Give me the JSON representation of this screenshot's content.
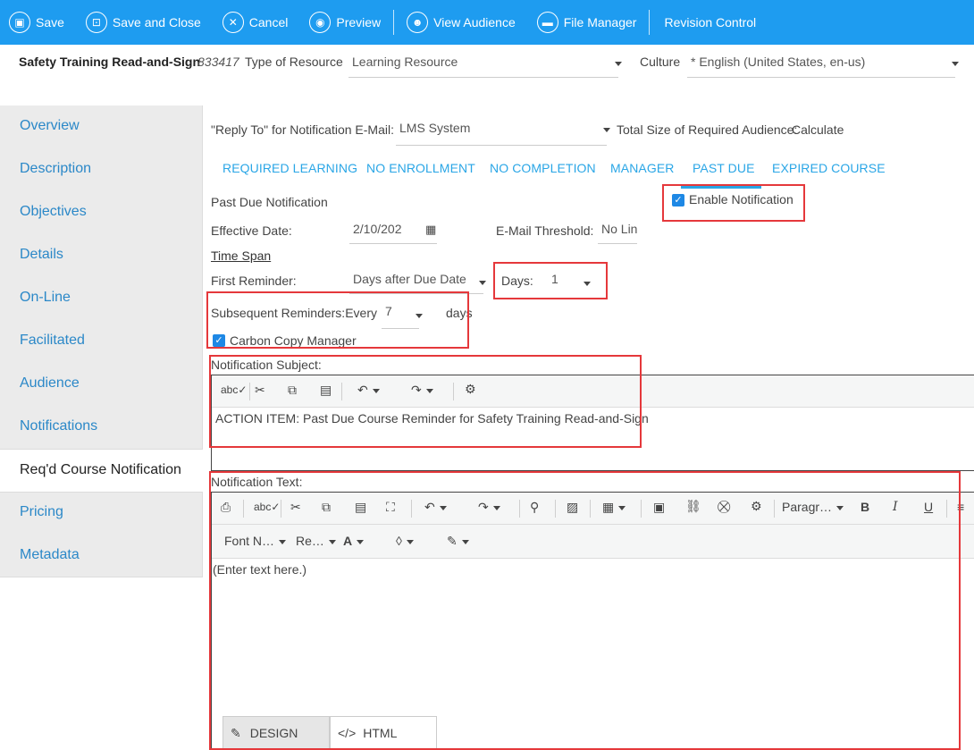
{
  "toolbar": {
    "save": "Save",
    "save_close": "Save and Close",
    "cancel": "Cancel",
    "preview": "Preview",
    "view_audience": "View Audience",
    "file_manager": "File Manager",
    "revision_control": "Revision Control"
  },
  "header": {
    "title": "Safety Training Read-and-Sign",
    "id": "833417",
    "type_label": "Type of Resource",
    "type_value": "Learning Resource",
    "culture_label": "Culture",
    "culture_value": "* English (United States, en-us)"
  },
  "sidebar": {
    "items": [
      "Overview",
      "Description",
      "Objectives",
      "Details",
      "On-Line",
      "Facilitated",
      "Audience",
      "Notifications",
      "Req'd Course Notification",
      "Pricing",
      "Metadata"
    ],
    "active_index": 8
  },
  "main": {
    "reply_to_label": "\"Reply To\" for Notification E-Mail:",
    "reply_to_value": "LMS System",
    "total_size_label": "Total Size of Required Audience:",
    "total_size_link": "Calculate",
    "tabs": [
      "REQUIRED LEARNING",
      "NO ENROLLMENT",
      "NO COMPLETION",
      "MANAGER",
      "PAST DUE",
      "EXPIRED COURSE"
    ],
    "active_tab": "PAST DUE",
    "section_title": "Past Due Notification",
    "enable_notification": "Enable Notification",
    "effective_date_label": "Effective Date:",
    "effective_date_value": "2/10/202",
    "email_threshold_label": "E-Mail Threshold:",
    "email_threshold_value": "No Lin",
    "time_span": "Time Span",
    "first_reminder_label": "First Reminder:",
    "first_reminder_value": "Days after Due Date",
    "days_label": "Days:",
    "days_value": "1",
    "subsequent_label": "Subsequent Reminders:Every",
    "subsequent_value": "7",
    "subsequent_unit": "days",
    "cc_manager": "Carbon Copy Manager",
    "subject_label": "Notification Subject:",
    "subject_value": "ACTION ITEM: Past Due Course Reminder for Safety Training Read-and-Sign",
    "text_label": "Notification Text:",
    "text_placeholder": "(Enter text here.)",
    "paragraph": "Paragr…",
    "font_name": "Font N…",
    "font_size": "Re…",
    "design_tab": "DESIGN",
    "html_tab": "HTML"
  },
  "colors": {
    "accent": "#1e9cf0",
    "highlight": "#e5383b",
    "link": "#2aa6e6"
  }
}
